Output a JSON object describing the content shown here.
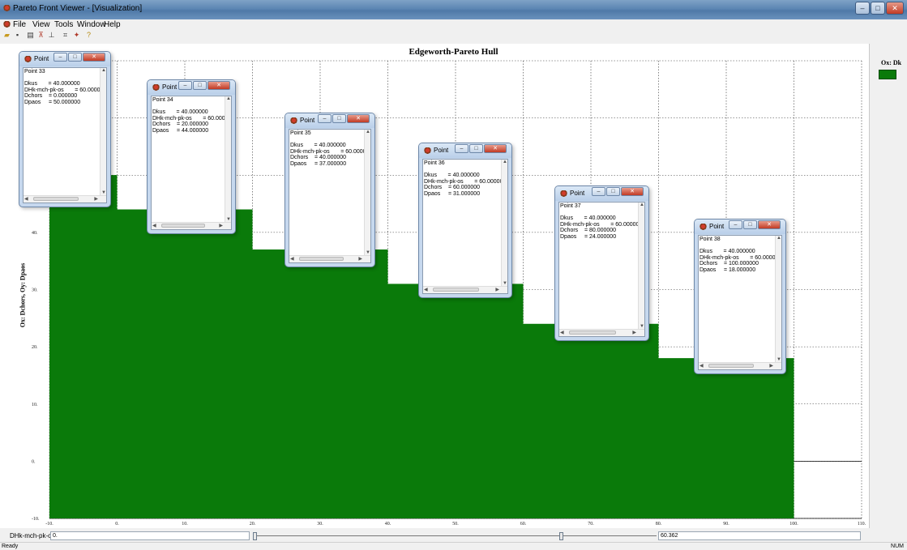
{
  "app": {
    "window_title": "Pareto Front Viewer - [Visualization]",
    "menu": [
      "File",
      "View",
      "Tools",
      "Window",
      "Help"
    ]
  },
  "chart_data": {
    "type": "area",
    "title": "Edgeworth-Pareto Hull",
    "xlabel": "",
    "ylabel": "Ox: Dchors,  Oy: Dpaos",
    "xlim": [
      -10,
      110
    ],
    "ylim": [
      -10,
      60
    ],
    "x_ticks": [
      "-10.",
      "0.",
      "10.",
      "20.",
      "30.",
      "40.",
      "50.",
      "60.",
      "70.",
      "80.",
      "90.",
      "100.",
      "110."
    ],
    "y_ticks": [
      "-10.",
      "0.",
      "10.",
      "20.",
      "30.",
      "40.",
      "50."
    ],
    "series": [
      {
        "name": "",
        "x": [
          0,
          20,
          40,
          60,
          80,
          100
        ],
        "values": [
          50,
          44,
          37,
          31,
          24,
          18
        ]
      }
    ],
    "fill_color": "#0a7a0a",
    "grid": true,
    "grid_style": "dotted",
    "legend_title": "Ox: Dk",
    "legend_position": "right"
  },
  "points": [
    {
      "title": "Point",
      "id": "Point 33",
      "dkus": "Dkus       = 40.000000",
      "dhk": "DHk-mch-pk-os       = 60.000000",
      "dchors": "Dchors    = 0.000000",
      "dpaos": "Dpaos     = 50.000000"
    },
    {
      "title": "Point",
      "id": "Point 34",
      "dkus": "Dkus       = 40.000000",
      "dhk": "DHk-mch-pk-os       = 60.000000",
      "dchors": "Dchors    = 20.000000",
      "dpaos": "Dpaos     = 44.000000"
    },
    {
      "title": "Point",
      "id": "Point 35",
      "dkus": "Dkus       = 40.000000",
      "dhk": "DHk-mch-pk-os       = 60.000000",
      "dchors": "Dchors    = 40.000000",
      "dpaos": "Dpaos     = 37.000000"
    },
    {
      "title": "Point",
      "id": "Point 36",
      "dkus": "Dkus       = 40.000000",
      "dhk": "DHk-mch-pk-os       = 60.000000",
      "dchors": "Dchors    = 60.000000",
      "dpaos": "Dpaos     = 31.000000"
    },
    {
      "title": "Point",
      "id": "Point 37",
      "dkus": "Dkus       = 40.000000",
      "dhk": "DHk-mch-pk-os       = 60.000000",
      "dchors": "Dchors    = 80.000000",
      "dpaos": "Dpaos     = 24.000000"
    },
    {
      "title": "Point",
      "id": "Point 38",
      "dkus": "Dkus       = 40.000000",
      "dhk": "DHk-mch-pk-os       = 60.000000",
      "dchors": "Dchors    = 100.000000",
      "dpaos": "Dpaos     = 18.000000"
    }
  ],
  "slider": {
    "label": "DHk-mch-pk-os",
    "min_value": "0.",
    "max_value": "60.362"
  },
  "status": {
    "text": "Ready",
    "right": "NUM"
  }
}
